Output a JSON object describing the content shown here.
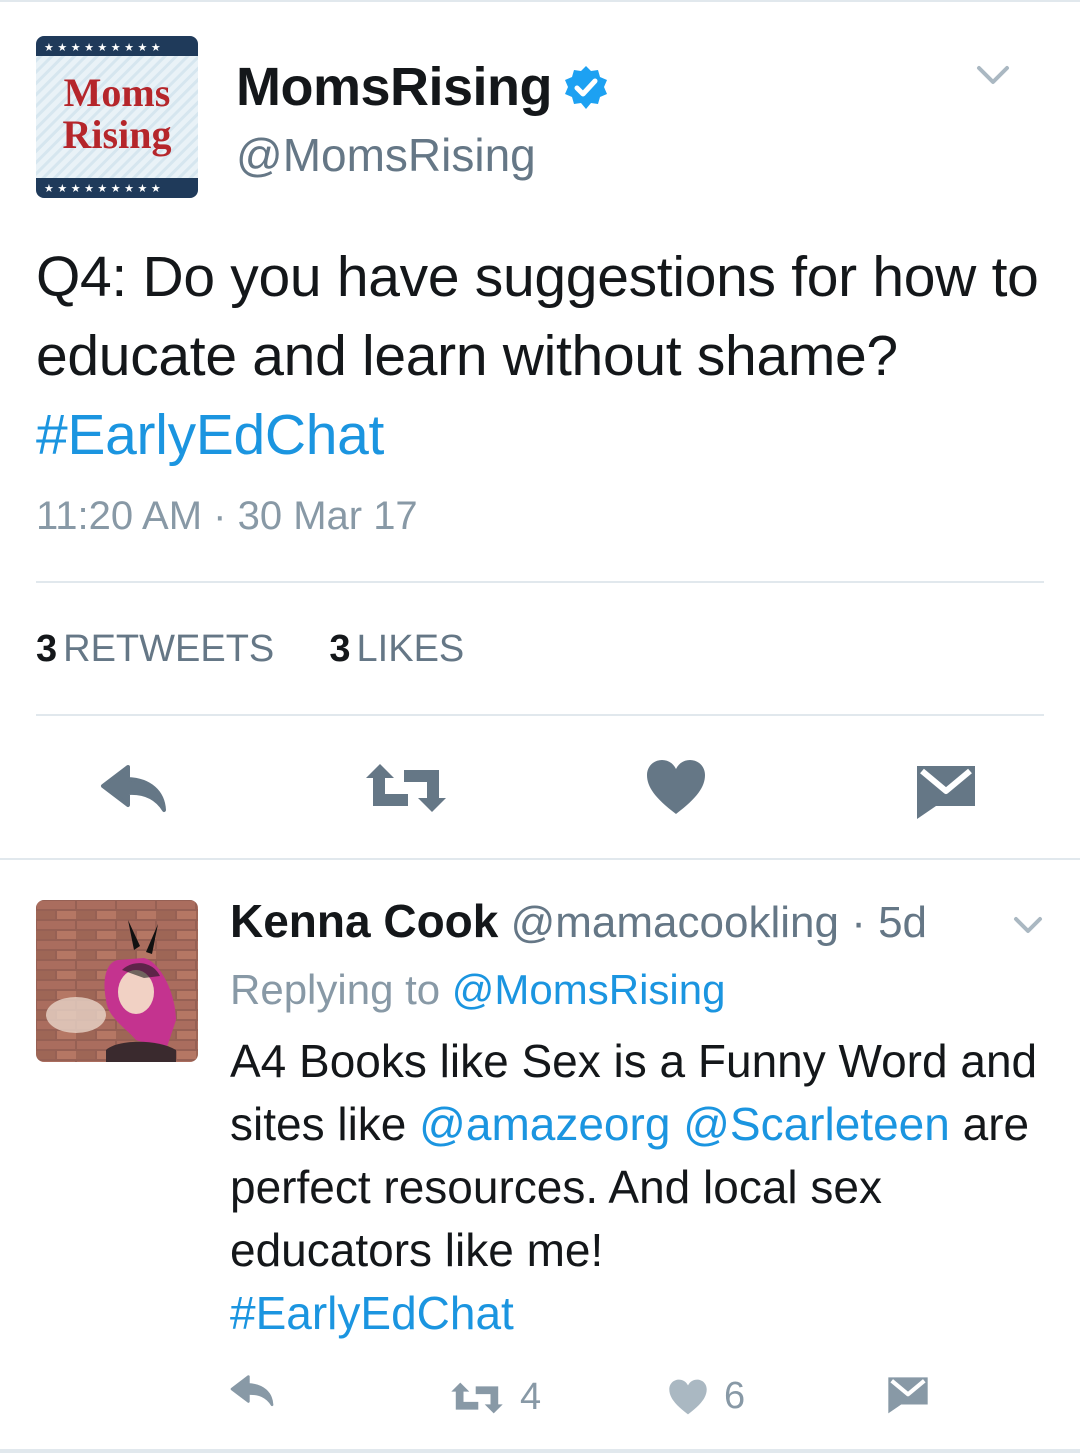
{
  "main_tweet": {
    "avatar_logo_text": [
      "Moms",
      "Rising"
    ],
    "display_name": "MomsRising",
    "handle": "@MomsRising",
    "text": "Q4: Do you have suggestions for how to educate and learn without shame?",
    "hashtag": "#EarlyEdChat",
    "timestamp": "11:20 AM · 30 Mar 17",
    "retweet_count": "3",
    "retweets_label": "RETWEETS",
    "like_count": "3",
    "likes_label": "LIKES",
    "actions": [
      "reply-icon",
      "retweet-icon",
      "heart-icon",
      "message-icon"
    ]
  },
  "reply_tweet": {
    "display_name": "Kenna Cook",
    "handle": "@mamacookling",
    "age": "· 5d",
    "replying_prefix": "Replying to",
    "replying_to": "@MomsRising",
    "text_1": "A4 Books like Sex is a Funny Word and sites like",
    "mention_1": "@amazeorg",
    "mention_2": "@Scarleteen",
    "text_2": "are perfect resources. And local sex educators like me!",
    "hashtag": "#EarlyEdChat",
    "retweet_count": "4",
    "like_count": "6"
  },
  "colors": {
    "link": "#1b95e0",
    "icon": "#657786",
    "secondary": "#8899a6",
    "logo_navy": "#1f3a5a",
    "logo_red": "#b5262b"
  }
}
